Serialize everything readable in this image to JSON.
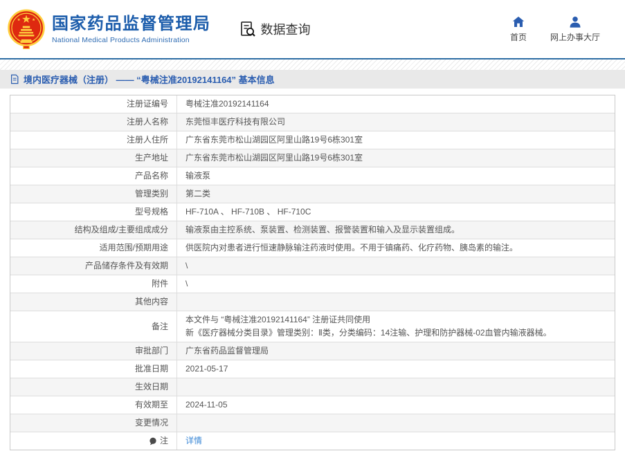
{
  "header": {
    "logo": {
      "title": "国家药品监督管理局",
      "subtitle": "National Medical Products Administration"
    },
    "data_query_label": "数据查询",
    "nav": [
      {
        "label": "首页",
        "icon": "home-icon"
      },
      {
        "label": "网上办事大厅",
        "icon": "person-icon"
      }
    ]
  },
  "breadcrumb": {
    "icon": "document-icon",
    "text": "境内医疗器械（注册） —— “粤械注准20192141164” 基本信息"
  },
  "table": {
    "rows": [
      {
        "label": "注册证编号",
        "value": "粤械注准20192141164"
      },
      {
        "label": "注册人名称",
        "value": "东莞恒丰医疗科技有限公司"
      },
      {
        "label": "注册人住所",
        "value": "广东省东莞市松山湖园区阿里山路19号6栋301室"
      },
      {
        "label": "生产地址",
        "value": "广东省东莞市松山湖园区阿里山路19号6栋301室"
      },
      {
        "label": "产品名称",
        "value": "输液泵"
      },
      {
        "label": "管理类别",
        "value": "第二类"
      },
      {
        "label": "型号规格",
        "value": "HF-710A 、 HF-710B 、 HF-710C"
      },
      {
        "label": "结构及组成/主要组成成分",
        "value": "输液泵由主控系统、泵装置、检测装置、报警装置和输入及显示装置组成。"
      },
      {
        "label": "适用范围/预期用途",
        "value": "供医院内对患者进行恒速静脉输注药液时使用。不用于镇痛药、化疗药物、胰岛素的输注。"
      },
      {
        "label": "产品储存条件及有效期",
        "value": "\\"
      },
      {
        "label": "附件",
        "value": "\\"
      },
      {
        "label": "其他内容",
        "value": ""
      },
      {
        "label": "备注",
        "value": "本文件与 “粤械注准20192141164” 注册证共同使用\n新《医疗器械分类目录》管理类别：Ⅱ类，分类编码：14注输、护理和防护器械-02血管内输液器械。"
      },
      {
        "label": "审批部门",
        "value": "广东省药品监督管理局"
      },
      {
        "label": "批准日期",
        "value": "2021-05-17"
      },
      {
        "label": "生效日期",
        "value": ""
      },
      {
        "label": "有效期至",
        "value": "2024-11-05"
      },
      {
        "label": "变更情况",
        "value": ""
      },
      {
        "label": "注",
        "value": "详情"
      }
    ]
  },
  "colors": {
    "brand_blue": "#1b5cab",
    "icon_blue": "#2a5db0",
    "link_blue": "#3a87d6",
    "divider_blue": "#2e6da4",
    "breadcrumb_bg": "#e9e9e9",
    "row_alt_bg": "#f5f5f5",
    "emblem_red": "#de2910",
    "emblem_gold": "#ffcf3e"
  }
}
